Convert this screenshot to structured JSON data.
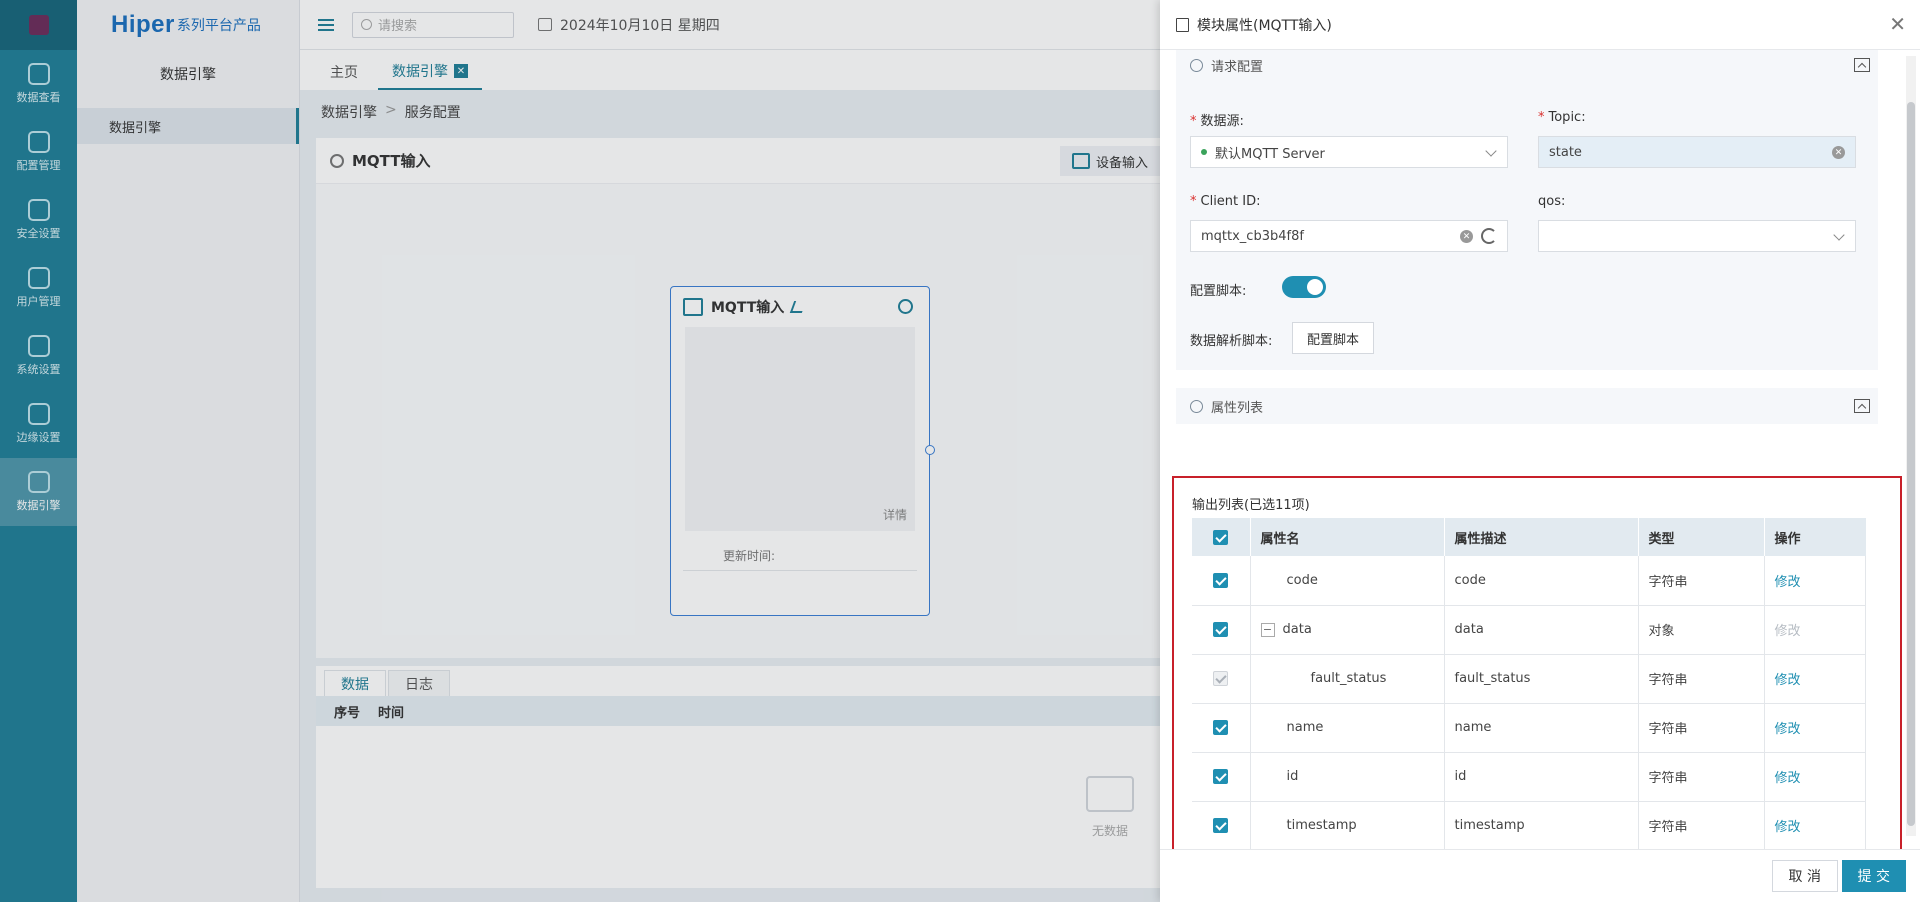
{
  "rail": {
    "items": [
      {
        "label": "数据查看",
        "icon": "cube-icon"
      },
      {
        "label": "配置管理",
        "icon": "printer-icon"
      },
      {
        "label": "安全设置",
        "icon": "house-lock-icon"
      },
      {
        "label": "用户管理",
        "icon": "shield-icon"
      },
      {
        "label": "系统设置",
        "icon": "settings-panel-icon"
      },
      {
        "label": "边缘设置",
        "icon": "network-icon"
      },
      {
        "label": "数据引擎",
        "icon": "data-engine-icon",
        "active": true
      }
    ]
  },
  "brand": {
    "name": "Hiper",
    "suffix": "系列平台产品"
  },
  "sidebar": {
    "title": "数据引擎",
    "items": [
      {
        "label": "数据引擎"
      }
    ]
  },
  "topbar": {
    "search_placeholder": "请搜索",
    "date": "2024年10月10日 星期四"
  },
  "tabs": [
    {
      "label": "主页"
    },
    {
      "label": "数据引擎",
      "active": true
    }
  ],
  "breadcrumb": {
    "first": "数据引擎",
    "sep": ">",
    "second": "服务配置"
  },
  "card": {
    "title": "MQTT输入",
    "device_button": "设备输入"
  },
  "node": {
    "title": "MQTT输入",
    "detail": "详情",
    "update_label": "更新时间:"
  },
  "bottom": {
    "tabs": [
      {
        "label": "数据",
        "active": true
      },
      {
        "label": "日志"
      }
    ],
    "columns": [
      "序号",
      "时间"
    ],
    "empty_text": "无数据"
  },
  "drawer": {
    "title": "模块属性(MQTT输入)",
    "request_section": "请求配置",
    "fields": {
      "datasource_label": "数据源:",
      "datasource_value": "默认MQTT Server",
      "topic_label": "Topic:",
      "topic_value": "state",
      "client_label": "Client ID:",
      "client_value": "mqttx_cb3b4f8f",
      "qos_label": "qos:",
      "qos_value": "",
      "script_label": "配置脚本:",
      "parse_label": "数据解析脚本:",
      "parse_button": "配置脚本"
    },
    "attr_section": "属性列表",
    "output_caption": "输出列表(已选11项)",
    "table": {
      "headers": [
        "属性名",
        "属性描述",
        "类型",
        "操作"
      ],
      "rows": [
        {
          "name": "code",
          "desc": "code",
          "type": "字符串",
          "action": "修改"
        },
        {
          "name": "data",
          "desc": "data",
          "type": "对象",
          "action": "修改"
        },
        {
          "name": "fault_status",
          "desc": "fault_status",
          "type": "字符串",
          "action": "修改"
        },
        {
          "name": "name",
          "desc": "name",
          "type": "字符串",
          "action": "修改"
        },
        {
          "name": "id",
          "desc": "id",
          "type": "字符串",
          "action": "修改"
        },
        {
          "name": "timestamp",
          "desc": "timestamp",
          "type": "字符串",
          "action": "修改"
        }
      ]
    },
    "cancel": "取 消",
    "submit": "提 交"
  }
}
